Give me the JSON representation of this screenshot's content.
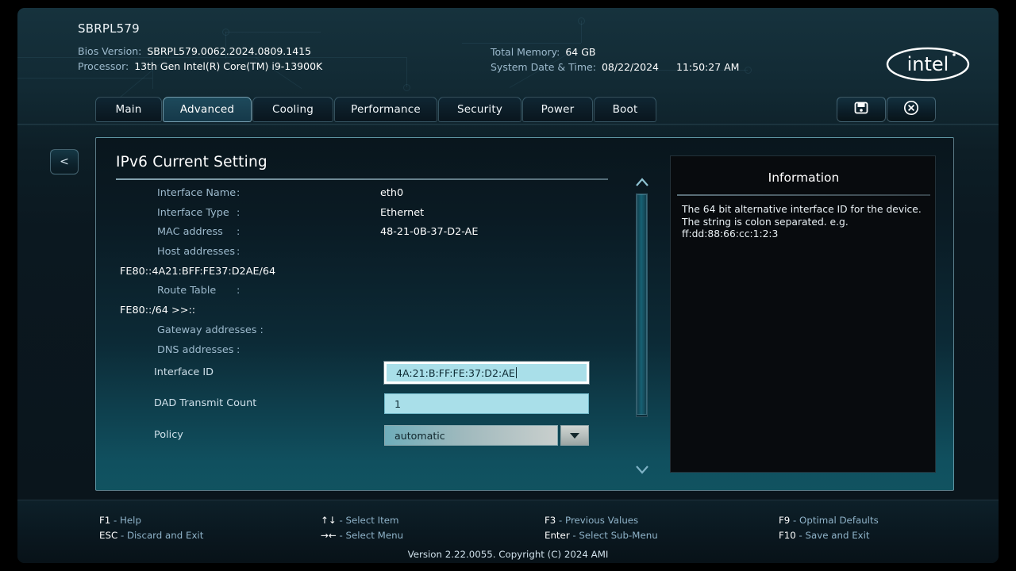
{
  "header": {
    "board_name": "SBRPL579",
    "bios_version_label": "Bios Version:",
    "bios_version_value": "SBRPL579.0062.2024.0809.1415",
    "processor_label": "Processor:",
    "processor_value": "13th Gen Intel(R) Core(TM) i9-13900K",
    "total_memory_label": "Total Memory:",
    "total_memory_value": "64 GB",
    "datetime_label": "System Date & Time:",
    "date_value": "08/22/2024",
    "time_value": "11:50:27 AM",
    "logo_text": "intel"
  },
  "tabs": [
    {
      "label": "Main",
      "active": false
    },
    {
      "label": "Advanced",
      "active": true
    },
    {
      "label": "Cooling",
      "active": false
    },
    {
      "label": "Performance",
      "active": false
    },
    {
      "label": "Security",
      "active": false
    },
    {
      "label": "Power",
      "active": false
    },
    {
      "label": "Boot",
      "active": false
    }
  ],
  "top_actions": {
    "save_icon": "save-disk-icon",
    "close_icon": "close-circle-icon"
  },
  "back_button": {
    "label": "<"
  },
  "main": {
    "section_title": "IPv6 Current Setting",
    "rows": [
      {
        "label": "Interface Name",
        "colon": ":",
        "value": "eth0"
      },
      {
        "label": "Interface Type",
        "colon": ":",
        "value": "Ethernet"
      },
      {
        "label": "MAC address",
        "colon": ":",
        "value": "48-21-0B-37-D2-AE"
      },
      {
        "label": "Host addresses",
        "colon": ":",
        "value": ""
      }
    ],
    "host_address_value": "FE80::4A21:BFF:FE37:D2AE/64",
    "route_table_label": "Route Table",
    "route_table_colon": ":",
    "route_table_value": "FE80::/64 >>::",
    "gateway_label": "Gateway addresses :",
    "dns_label": "DNS addresses",
    "dns_colon": ":",
    "fields": {
      "interface_id_label": "Interface ID",
      "interface_id_value": "4A:21:B:FF:FE:37:D2:AE",
      "dad_label": "DAD Transmit Count",
      "dad_value": "1",
      "policy_label": "Policy",
      "policy_value": "automatic"
    }
  },
  "info": {
    "title": "Information",
    "line1": "The 64 bit alternative interface ID for the device.",
    "line2": "The string is colon separated. e.g.",
    "line3": "ff:dd:88:66:cc:1:2:3"
  },
  "footer": {
    "keys": [
      {
        "key": "F1",
        "desc": "- Help"
      },
      {
        "key": "ESC",
        "desc": "- Discard and Exit"
      },
      {
        "key": "↑↓",
        "desc": "- Select Item"
      },
      {
        "key": "→←",
        "desc": "- Select Menu"
      },
      {
        "key": "F3",
        "desc": "- Previous Values"
      },
      {
        "key": "Enter",
        "desc": "- Select Sub-Menu"
      },
      {
        "key": "F9",
        "desc": "- Optimal Defaults"
      },
      {
        "key": "F10",
        "desc": "- Save and Exit"
      }
    ],
    "version": "Version 2.22.0055. Copyright (C) 2024 AMI"
  },
  "colors": {
    "accent_teal": "#115360",
    "label_blue": "#9dbacd",
    "field_cyan": "#a9dfe9",
    "panel_black": "#080b0e"
  }
}
